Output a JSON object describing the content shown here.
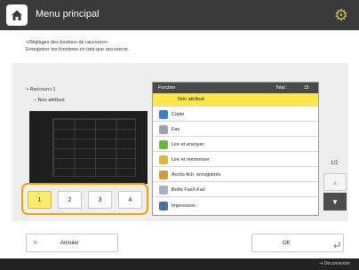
{
  "header": {
    "title": "Menu principal",
    "home_icon": "home-icon",
    "settings_icon": "gear-icon"
  },
  "instructions": {
    "line1": "<Réglages des boutons de raccourci>",
    "line2": "Enregistrer les fonctions en tant que raccourcis."
  },
  "tree": {
    "item1": "• Raccourci 1",
    "item2": "– Non attribué"
  },
  "page_buttons": [
    {
      "label": "1",
      "selected": true
    },
    {
      "label": "2",
      "selected": false
    },
    {
      "label": "3",
      "selected": false
    },
    {
      "label": "4",
      "selected": false
    }
  ],
  "table": {
    "col_function": "Fonction",
    "col_total": "Total :",
    "total": "15",
    "rows": [
      {
        "label": "Non attribué",
        "icon": "none",
        "selected": true
      },
      {
        "label": "Copie",
        "icon": "copy-icon",
        "selected": false
      },
      {
        "label": "Fax",
        "icon": "fax-icon",
        "selected": false
      },
      {
        "label": "Lire et envoyer",
        "icon": "scan-send-icon",
        "selected": false
      },
      {
        "label": "Lire et mémoriser",
        "icon": "scan-store-icon",
        "selected": false
      },
      {
        "label": "Accès fich. enregistrés",
        "icon": "stored-files-icon",
        "selected": false
      },
      {
        "label": "Boîte Fax/I-Fax",
        "icon": "fax-inbox-icon",
        "selected": false
      },
      {
        "label": "Impression",
        "icon": "print-icon",
        "selected": false
      }
    ]
  },
  "pager": {
    "count": "1/2"
  },
  "footer": {
    "cancel_label": "Annuler",
    "ok_label": "OK"
  },
  "statusbar": {
    "logout_label": "Déconnexion"
  },
  "colors": {
    "accent_orange": "#f0a100",
    "selected_yellow": "#fbe74c",
    "header_dark": "#3a3a3a"
  }
}
